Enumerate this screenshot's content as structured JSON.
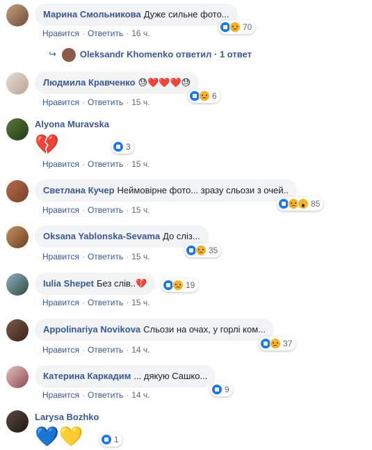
{
  "actions": {
    "like": "Нравится",
    "reply": "Ответить"
  },
  "comments": [
    {
      "author": "Марина Смольникова",
      "text": "Дуже сильне фото...",
      "time": "16 ч.",
      "count": "70"
    },
    {
      "author": "Людмила Кравченко",
      "text": "😓❤️❤️❤️😓",
      "time": "15 ч.",
      "count": "6"
    },
    {
      "author": "Alyona Muravska",
      "text": "💔",
      "time": "15 ч.",
      "count": "3"
    },
    {
      "author": "Светлана Кучер",
      "text": "Неймовірне фото... зразу сльози з очей..",
      "time": "15 ч.",
      "count": "85"
    },
    {
      "author": "Oksana Yablonska-Sevama",
      "text": "До сліз...",
      "time": "15 ч.",
      "count": "35"
    },
    {
      "author": "Iulia Shepet",
      "text": "Без слів..💔",
      "time": "15 ч.",
      "count": "19"
    },
    {
      "author": "Appolinariya Novikova",
      "text": "Сльози на очах, у горлі ком...",
      "time": "14 ч.",
      "count": "37"
    },
    {
      "author": "Катерина Каркадим",
      "text": "... дякую Сашко...",
      "time": "14 ч.",
      "count": "9"
    },
    {
      "author": "Larysa Bozhko",
      "text": "💙💛",
      "time": "",
      "count": "1"
    }
  ],
  "reply_thread": {
    "author": "Oleksandr Khomenko",
    "label": "ответил",
    "count": "· 1 ответ"
  }
}
